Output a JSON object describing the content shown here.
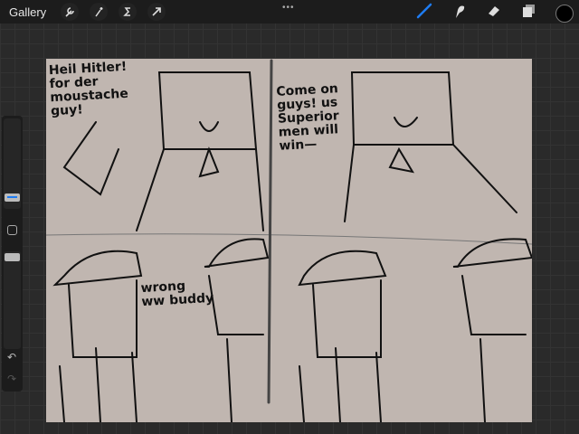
{
  "topbar": {
    "gallery": "Gallery",
    "tools_left": [
      "wrench-icon",
      "magic-wand-icon",
      "selection-icon",
      "move-arrow-icon"
    ],
    "tools_right": [
      "brush-icon",
      "smudge-icon",
      "eraser-icon",
      "layers-icon"
    ],
    "more": "•••",
    "current_color": "#000000",
    "accent": "#1e7cf2"
  },
  "canvas": {
    "background": "#c0b6b0",
    "bubble1": "Heil Hitler!\nfor der\nmoustache\nguy!",
    "bubble2": "Come on\nguys! us\nSuperior\nmen will\nwin—",
    "bubble3": "wrong\nww buddy"
  }
}
